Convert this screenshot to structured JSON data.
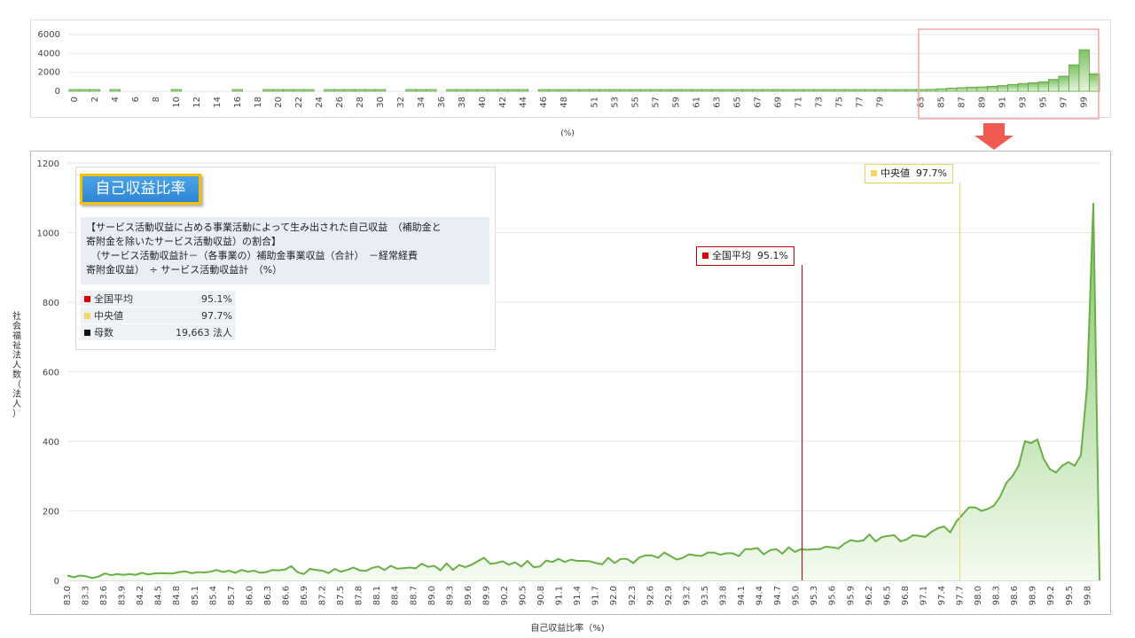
{
  "overview": {
    "xlabel": "(%)",
    "chart_data": {
      "type": "bar",
      "categories": [
        "0",
        "1",
        "2",
        "3",
        "4",
        "5",
        "6",
        "7",
        "8",
        "9",
        "10",
        "11",
        "12",
        "13",
        "14",
        "15",
        "16",
        "17",
        "18",
        "19",
        "20",
        "21",
        "22",
        "23",
        "24",
        "25",
        "26",
        "27",
        "28",
        "29",
        "30",
        "31",
        "32",
        "33",
        "34",
        "35",
        "36",
        "37",
        "38",
        "39",
        "40",
        "41",
        "42",
        "43",
        "44",
        "45",
        "46",
        "47",
        "48",
        "49",
        "50",
        "51",
        "52",
        "53",
        "54",
        "55",
        "56",
        "57",
        "58",
        "59",
        "60",
        "61",
        "62",
        "63",
        "64",
        "65",
        "66",
        "67",
        "68",
        "69",
        "70",
        "71",
        "72",
        "73",
        "74",
        "75",
        "76",
        "77",
        "78",
        "79",
        "80",
        "81",
        "82",
        "83",
        "84",
        "85",
        "86",
        "87",
        "88",
        "89",
        "90",
        "91",
        "92",
        "93",
        "94",
        "95",
        "96",
        "97",
        "98",
        "99",
        "100"
      ],
      "tick_labels": [
        "0",
        "2",
        "4",
        "6",
        "8",
        "10",
        "12",
        "14",
        "16",
        "18",
        "20",
        "22",
        "24",
        "26",
        "28",
        "30",
        "32",
        "34",
        "36",
        "38",
        "40",
        "42",
        "44",
        "46",
        "48",
        "51",
        "53",
        "55",
        "57",
        "59",
        "61",
        "63",
        "65",
        "67",
        "69",
        "71",
        "73",
        "75",
        "77",
        "79",
        "83",
        "85",
        "87",
        "89",
        "91",
        "93",
        "95",
        "97",
        "99"
      ],
      "values": [
        100,
        100,
        100,
        0,
        100,
        0,
        0,
        0,
        0,
        0,
        100,
        0,
        0,
        0,
        0,
        0,
        100,
        0,
        0,
        100,
        100,
        100,
        100,
        100,
        0,
        100,
        100,
        100,
        100,
        100,
        100,
        0,
        0,
        100,
        100,
        100,
        0,
        100,
        100,
        100,
        100,
        100,
        100,
        100,
        100,
        0,
        100,
        100,
        100,
        100,
        100,
        100,
        100,
        100,
        100,
        100,
        100,
        100,
        100,
        100,
        100,
        100,
        100,
        100,
        100,
        100,
        100,
        100,
        100,
        100,
        100,
        100,
        100,
        100,
        100,
        100,
        100,
        100,
        100,
        100,
        100,
        100,
        100,
        150,
        200,
        260,
        320,
        380,
        420,
        460,
        520,
        600,
        720,
        820,
        900,
        1000,
        1250,
        1600,
        2800,
        4400,
        1850
      ],
      "yticks": [
        "0",
        "2000",
        "4000",
        "6000"
      ],
      "ylim": [
        0,
        6000
      ]
    }
  },
  "main": {
    "xlabel": "自己収益比率（%)",
    "ylabel": "社会福祉法人数（法人）",
    "chart_data": {
      "type": "area",
      "yticks": [
        "0",
        "200",
        "400",
        "600",
        "800",
        "1000",
        "1200"
      ],
      "ylim": [
        0,
        1200
      ],
      "xlim": [
        83.0,
        100.0
      ],
      "tick_labels": [
        "83.0",
        "83.3",
        "83.6",
        "83.9",
        "84.2",
        "84.5",
        "84.8",
        "85.1",
        "85.4",
        "85.7",
        "86.0",
        "86.3",
        "86.6",
        "86.9",
        "87.2",
        "87.5",
        "87.8",
        "88.1",
        "88.4",
        "88.7",
        "89.0",
        "89.3",
        "89.6",
        "89.9",
        "90.2",
        "90.5",
        "90.8",
        "91.1",
        "91.4",
        "91.7",
        "92.0",
        "92.3",
        "92.6",
        "92.9",
        "93.2",
        "93.5",
        "93.8",
        "94.1",
        "94.4",
        "94.7",
        "95.0",
        "95.3",
        "95.6",
        "95.9",
        "96.2",
        "96.5",
        "96.8",
        "97.1",
        "97.4",
        "97.7",
        "98.0",
        "98.3",
        "98.6",
        "98.9",
        "99.2",
        "99.5",
        "99.8"
      ],
      "values": [
        14,
        9,
        14,
        12,
        7,
        11,
        20,
        15,
        18,
        16,
        18,
        16,
        22,
        17,
        20,
        21,
        20,
        20,
        24,
        26,
        21,
        24,
        23,
        25,
        30,
        24,
        28,
        22,
        30,
        25,
        28,
        22,
        24,
        30,
        29,
        31,
        41,
        24,
        18,
        33,
        30,
        28,
        21,
        33,
        25,
        30,
        37,
        29,
        27,
        36,
        40,
        30,
        42,
        34,
        35,
        37,
        35,
        48,
        39,
        42,
        29,
        49,
        30,
        44,
        38,
        45,
        55,
        65,
        48,
        50,
        55,
        45,
        52,
        40,
        56,
        38,
        40,
        57,
        53,
        62,
        53,
        60,
        56,
        56,
        55,
        50,
        46,
        65,
        50,
        62,
        62,
        50,
        66,
        72,
        72,
        65,
        80,
        70,
        60,
        65,
        75,
        72,
        70,
        80,
        80,
        74,
        78,
        78,
        70,
        90,
        90,
        93,
        75,
        87,
        90,
        77,
        95,
        82,
        90,
        88,
        90,
        90,
        97,
        95,
        92,
        106,
        116,
        112,
        115,
        132,
        112,
        125,
        128,
        130,
        112,
        118,
        130,
        128,
        125,
        140,
        150,
        155,
        138,
        170,
        190,
        210,
        210,
        200,
        205,
        215,
        240,
        280,
        300,
        330,
        400,
        395,
        405,
        350,
        320,
        310,
        330,
        340,
        330,
        360,
        560,
        1085,
        0
      ],
      "markers": [
        {
          "label": "全国平均",
          "value_text": "95.1%",
          "x": 95.1,
          "color": "#c00000"
        },
        {
          "label": "中央値",
          "value_text": "97.7%",
          "x": 97.7,
          "color": "#f5d66a"
        }
      ]
    }
  },
  "info": {
    "title": "自己収益比率",
    "desc": [
      "【サービス活動収益に占める事業活動によって生み出された自己収益　（補助金と",
      "寄附金を除いたサービス活動収益）の割合】",
      "　（サービス活動収益計－（各事業の）補助金事業収益（合計）　－経常経費",
      "寄附金収益）　÷ サービス活動収益計　（%）"
    ],
    "stats": [
      {
        "label": "全国平均",
        "value": "95.1%",
        "color": "#e00000"
      },
      {
        "label": "中央値",
        "value": "97.7%",
        "color": "#f5d66a"
      },
      {
        "label": "母数",
        "value": "19,663 法人",
        "color": "#111111"
      }
    ]
  },
  "colors": {
    "bar_fill_top": "#86c56f",
    "bar_stroke": "#5aa23a",
    "line": "#6aae46",
    "highlight_box": "#f4a6a6",
    "arrow": "#f05a50"
  }
}
